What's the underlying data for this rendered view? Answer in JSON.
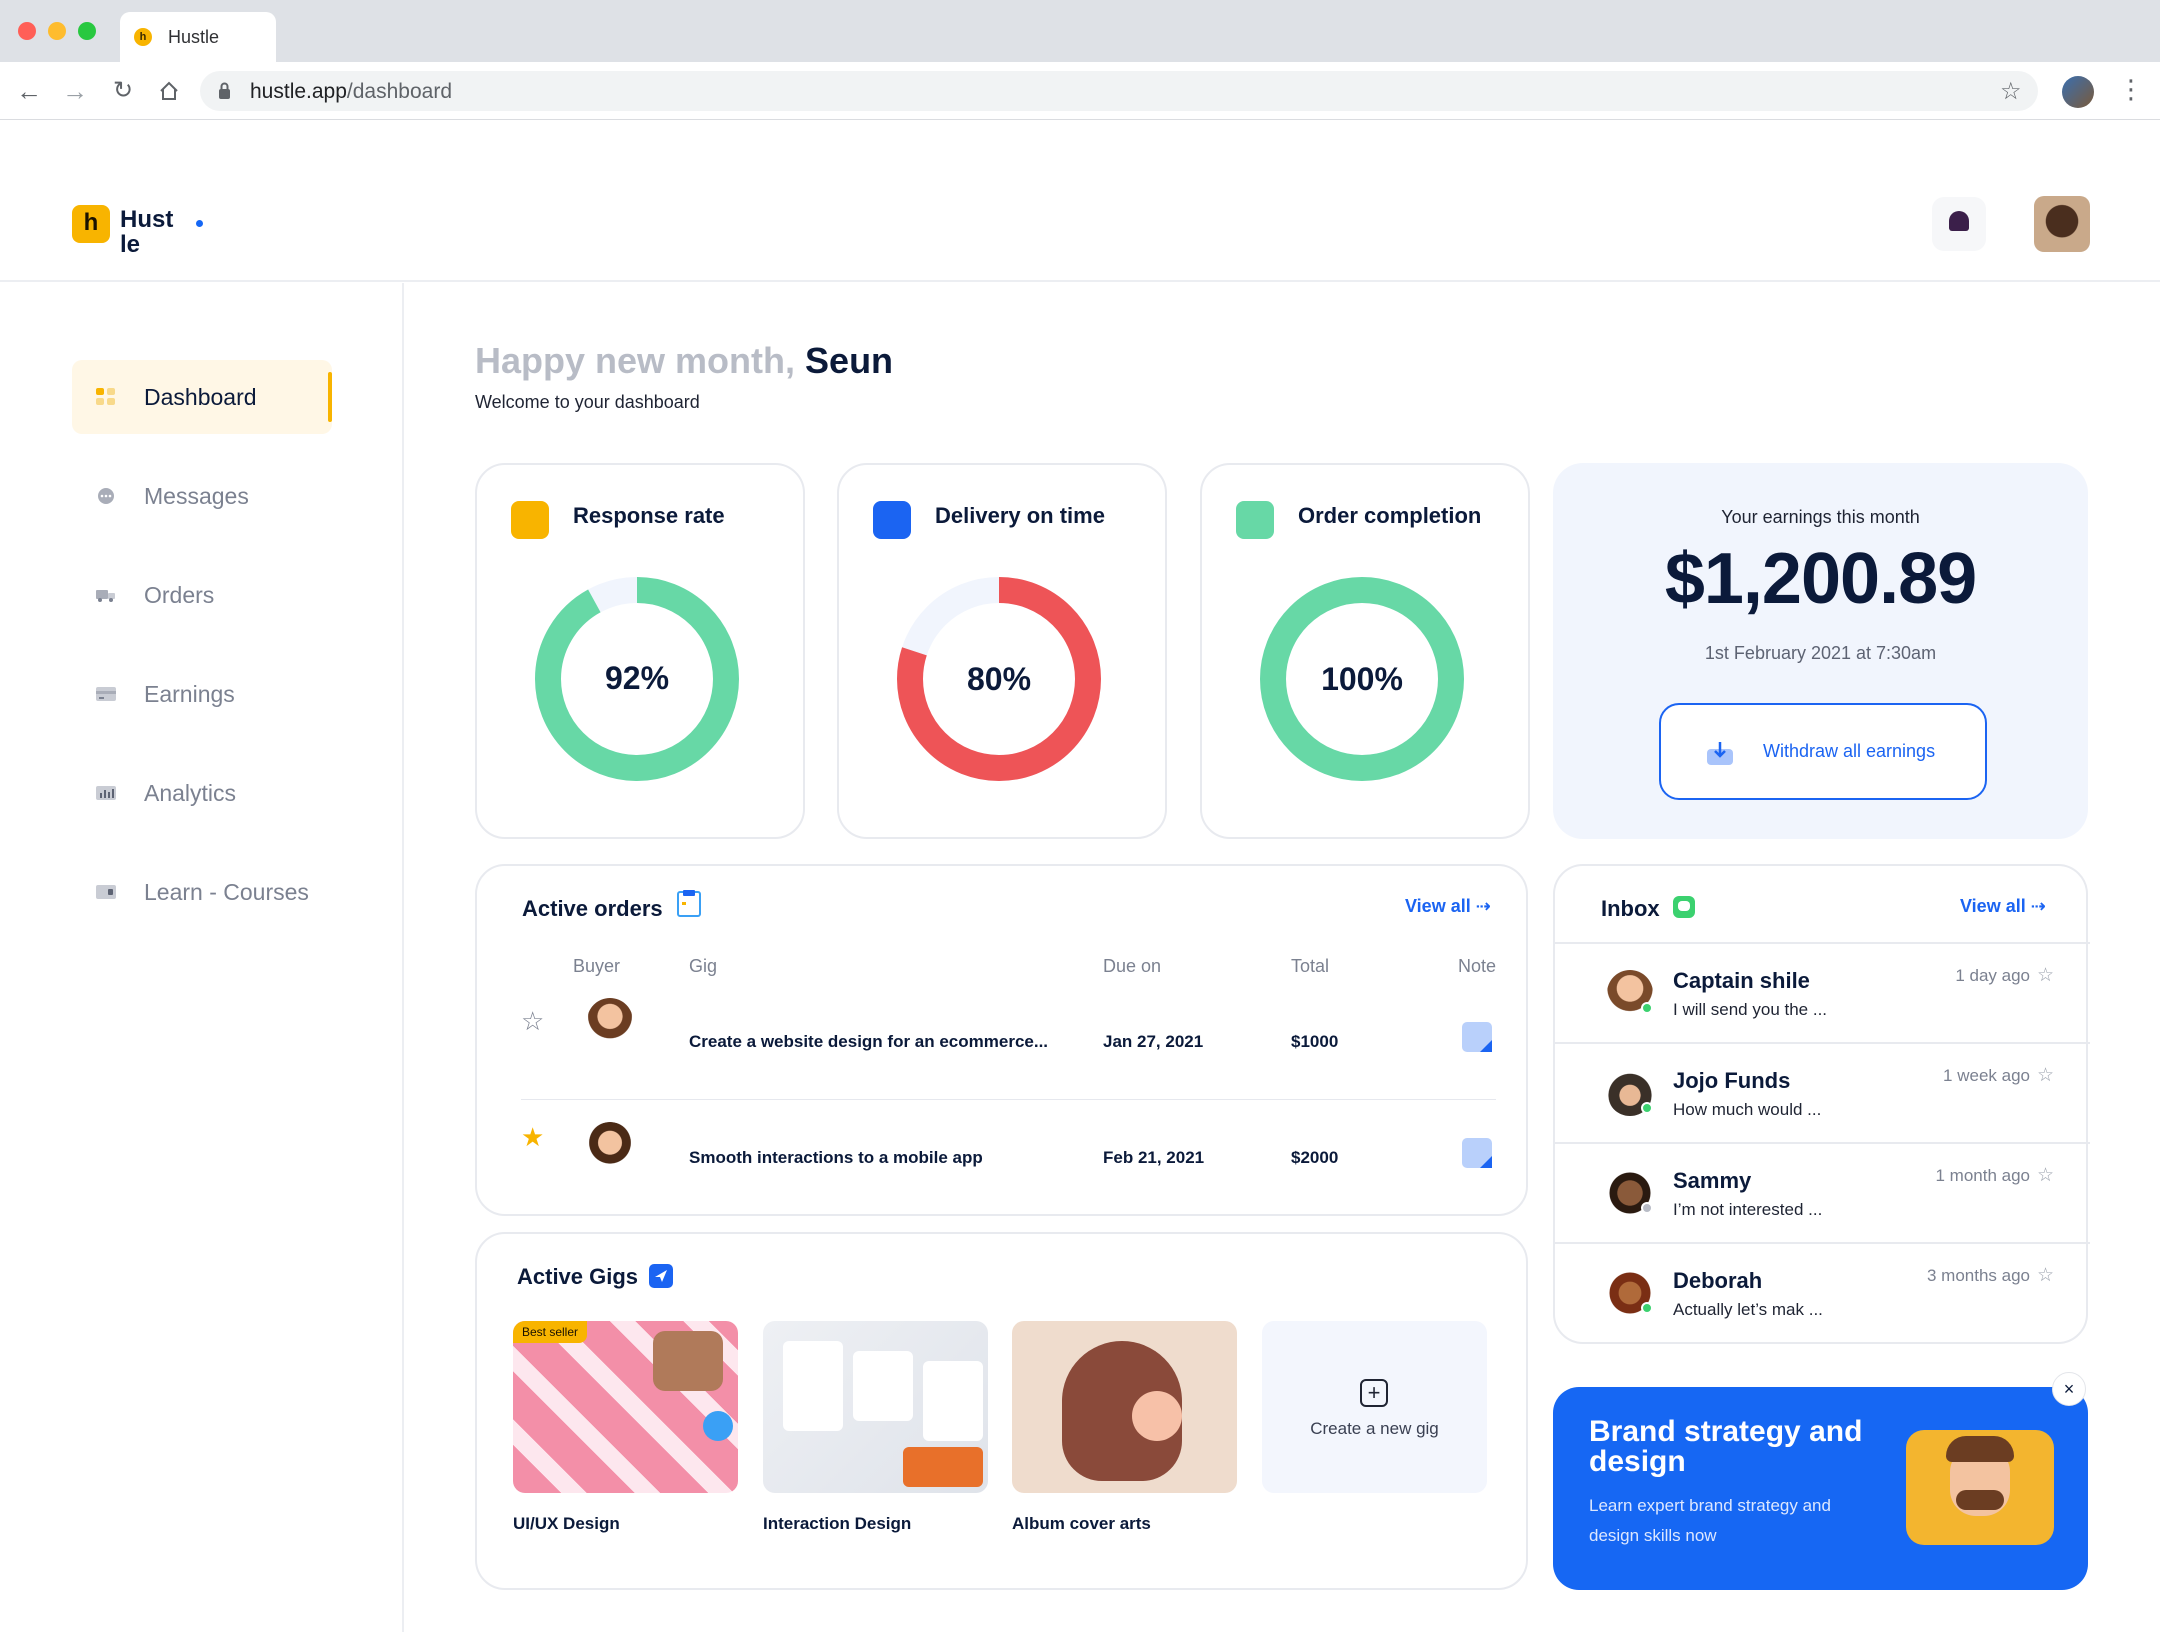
{
  "browser": {
    "tab_title": "Hustle",
    "favicon_letter": "h",
    "url_host": "hustle.app",
    "url_path": "/dashboard"
  },
  "header": {
    "logo_letter": "h",
    "logo_text": "Hustle"
  },
  "sidebar": {
    "items": [
      {
        "label": "Dashboard",
        "icon": "grid-icon"
      },
      {
        "label": "Messages",
        "icon": "chat-icon"
      },
      {
        "label": "Orders",
        "icon": "truck-icon"
      },
      {
        "label": "Earnings",
        "icon": "card-icon"
      },
      {
        "label": "Analytics",
        "icon": "bar-chart-icon"
      },
      {
        "label": "Learn - Courses",
        "icon": "course-icon"
      }
    ]
  },
  "greeting": {
    "prefix": "Happy new month,",
    "name": "Seun",
    "subtitle": "Welcome to your dashboard"
  },
  "kpis": [
    {
      "title": "Response rate",
      "value_text": "92%",
      "value": 92,
      "color": "#67d8a6",
      "icon_color": "#f8b400"
    },
    {
      "title": "Delivery on time",
      "value_text": "80%",
      "value": 80,
      "color": "#ee5457",
      "icon_color": "#1b64f2"
    },
    {
      "title": "Order completion",
      "value_text": "100%",
      "value": 100,
      "color": "#67d8a6",
      "icon_color": "#67d8a6"
    }
  ],
  "earnings": {
    "label": "Your earnings this month",
    "amount": "$1,200.89",
    "date": "1st February 2021 at 7:30am",
    "button": "Withdraw all earnings"
  },
  "active_orders": {
    "title": "Active orders",
    "view_all": "View all",
    "columns": {
      "buyer": "Buyer",
      "gig": "Gig",
      "due": "Due on",
      "total": "Total",
      "note": "Note"
    },
    "rows": [
      {
        "starred": false,
        "gig": "Create a website design for an ecommerce...",
        "due": "Jan 27, 2021",
        "total": "$1000"
      },
      {
        "starred": true,
        "gig": "Smooth interactions to a mobile app",
        "due": "Feb 21, 2021",
        "total": "$2000"
      }
    ]
  },
  "inbox": {
    "title": "Inbox",
    "view_all": "View all",
    "messages": [
      {
        "name": "Captain shile",
        "preview": "I will send you the ...",
        "time": "1 day ago",
        "online": true
      },
      {
        "name": "Jojo Funds",
        "preview": "How much would ...",
        "time": "1 week ago",
        "online": true
      },
      {
        "name": "Sammy",
        "preview": "I’m not interested ...",
        "time": "1 month ago",
        "online": false
      },
      {
        "name": "Deborah",
        "preview": "Actually let’s mak ...",
        "time": "3 months ago",
        "online": true
      }
    ]
  },
  "active_gigs": {
    "title": "Active Gigs",
    "badge": "Best seller",
    "gigs": [
      {
        "label": "UI/UX Design"
      },
      {
        "label": "Interaction Design"
      },
      {
        "label": "Album cover arts"
      }
    ],
    "create_label": "Create a new gig"
  },
  "promo": {
    "title": "Brand strategy and design",
    "subtitle": "Learn expert brand strategy and design skills now",
    "close": "×"
  },
  "colors": {
    "brand": "#f8b400",
    "accent": "#1b64f2",
    "success": "#67d8a6",
    "danger": "#ee5457"
  }
}
